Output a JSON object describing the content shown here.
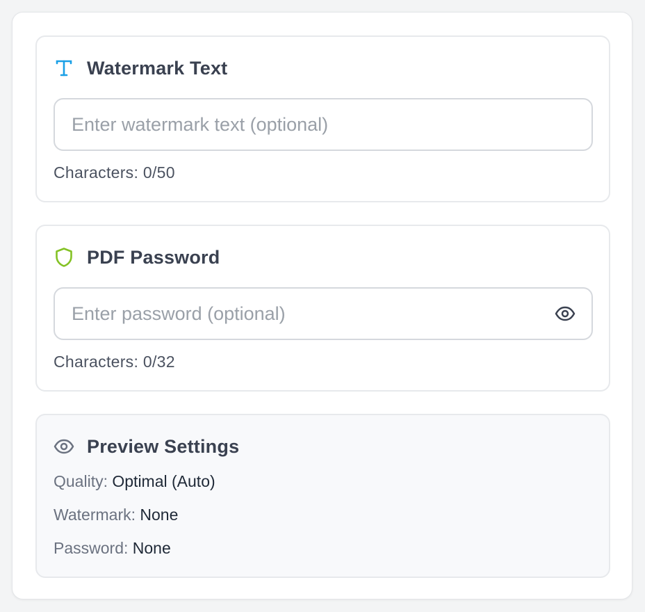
{
  "colors": {
    "watermark_icon": "#1aa0e6",
    "password_icon": "#84c225",
    "preview_icon": "#6b7280"
  },
  "watermark": {
    "icon": "text-type-icon",
    "title": "Watermark Text",
    "input_value": "",
    "placeholder": "Enter watermark text (optional)",
    "char_count": "Characters: 0/50"
  },
  "password": {
    "icon": "shield-icon",
    "title": "PDF Password",
    "input_value": "",
    "placeholder": "Enter password (optional)",
    "toggle_icon": "eye-icon",
    "char_count": "Characters: 0/32"
  },
  "preview": {
    "icon": "eye-icon",
    "title": "Preview Settings",
    "rows": [
      {
        "label": "Quality:",
        "value": "Optimal (Auto)"
      },
      {
        "label": "Watermark:",
        "value": "None"
      },
      {
        "label": "Password:",
        "value": "None"
      }
    ]
  }
}
